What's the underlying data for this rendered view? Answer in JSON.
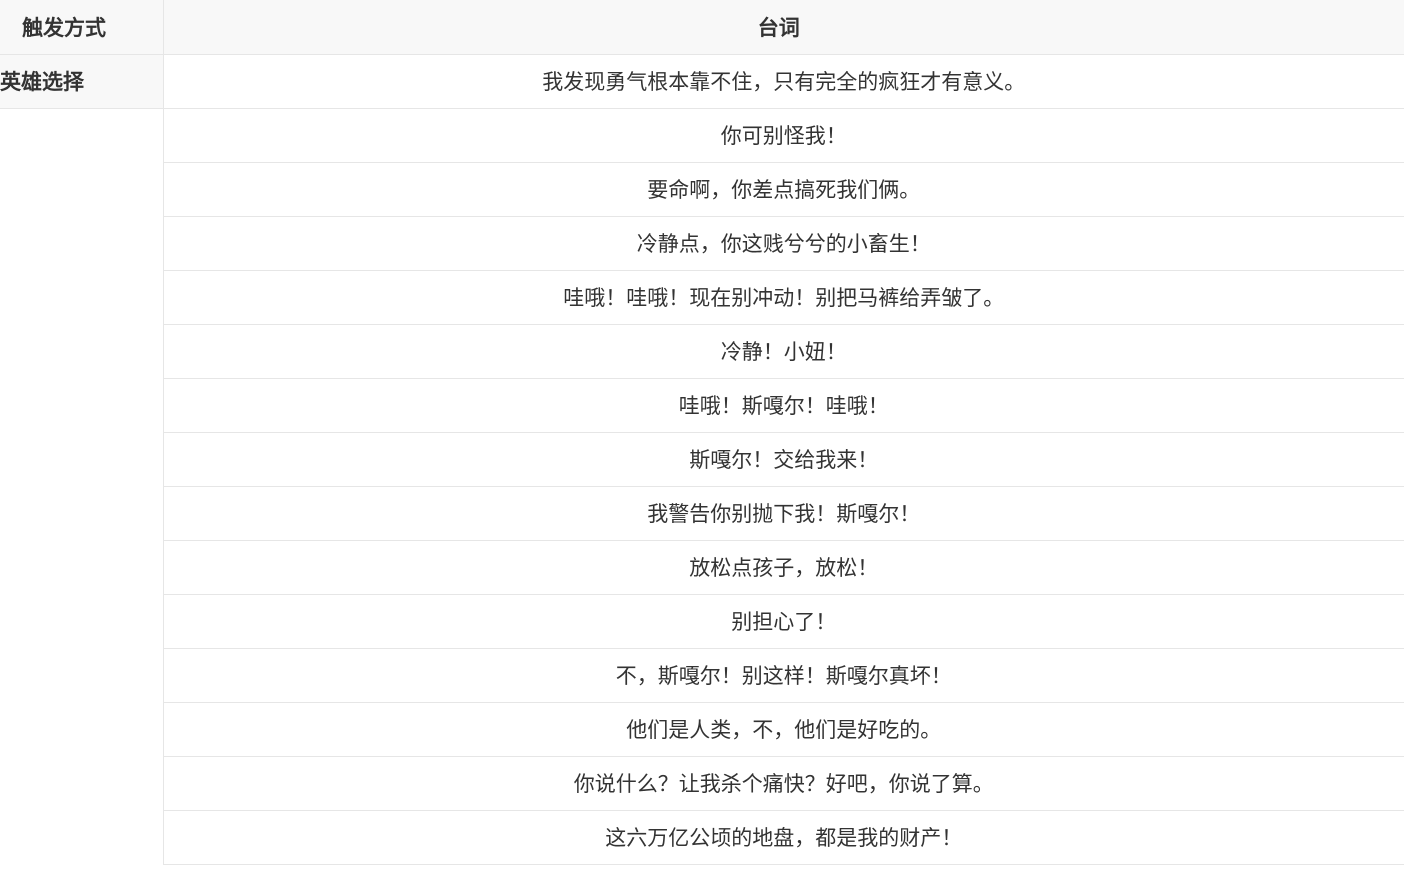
{
  "header": {
    "trigger": "触发方式",
    "line": "台词"
  },
  "rows": [
    {
      "trigger": "英雄选择",
      "line": "我发现勇气根本靠不住，只有完全的疯狂才有意义。"
    },
    {
      "trigger": "",
      "line": "你可别怪我！"
    },
    {
      "trigger": "",
      "line": "要命啊，你差点搞死我们俩。"
    },
    {
      "trigger": "",
      "line": "冷静点，你这贱兮兮的小畜生！"
    },
    {
      "trigger": "",
      "line": "哇哦！哇哦！现在别冲动！别把马裤给弄皱了。"
    },
    {
      "trigger": "",
      "line": "冷静！小妞！"
    },
    {
      "trigger": "",
      "line": "哇哦！斯嘎尔！哇哦！"
    },
    {
      "trigger": "",
      "line": "斯嘎尔！交给我来！"
    },
    {
      "trigger": "",
      "line": "我警告你别抛下我！斯嘎尔！"
    },
    {
      "trigger": "",
      "line": "放松点孩子，放松！"
    },
    {
      "trigger": "",
      "line": "别担心了！"
    },
    {
      "trigger": "",
      "line": "不，斯嘎尔！别这样！斯嘎尔真坏！"
    },
    {
      "trigger": "",
      "line": "他们是人类，不，他们是好吃的。"
    },
    {
      "trigger": "",
      "line": "你说什么？让我杀个痛快？好吧，你说了算。"
    },
    {
      "trigger": "",
      "line": "这六万亿公顷的地盘，都是我的财产！"
    }
  ]
}
